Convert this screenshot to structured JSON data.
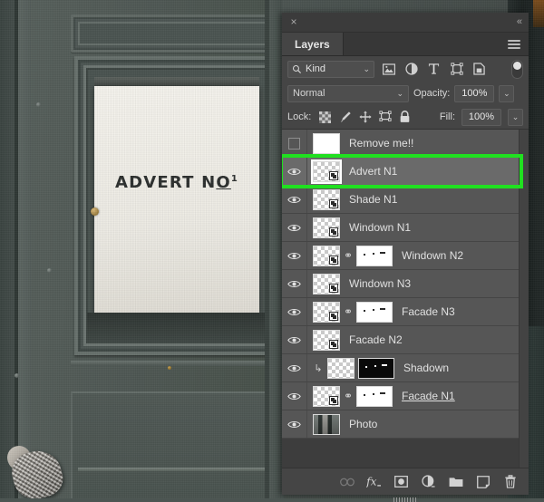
{
  "photo": {
    "poster_text_main": "ADVERT N",
    "poster_text_sup": "O",
    "poster_text_num": "1",
    "alt": "photo-of-dark-green-door-with-framed-advert-poster"
  },
  "panel": {
    "close_label": "×",
    "collapse_label": "«",
    "tab_label": "Layers",
    "menu_icon": "hamburger-menu-icon"
  },
  "filter_row": {
    "kind_label": "Kind",
    "search_icon": "search-icon",
    "caret": "⌄",
    "icons": [
      {
        "name": "filter-pixel-icon",
        "glyph": "image"
      },
      {
        "name": "filter-adjustment-icon",
        "glyph": "adjustment"
      },
      {
        "name": "filter-type-icon",
        "glyph": "T"
      },
      {
        "name": "filter-shape-icon",
        "glyph": "shape"
      },
      {
        "name": "filter-smart-object-icon",
        "glyph": "smart"
      }
    ],
    "toggle_name": "filter-enable-toggle"
  },
  "blend_row": {
    "blend_mode": "Normal",
    "opacity_label": "Opacity:",
    "opacity_value": "100%",
    "caret": "⌄"
  },
  "lock_row": {
    "lock_label": "Lock:",
    "fill_label": "Fill:",
    "fill_value": "100%",
    "caret": "⌄",
    "icons": [
      {
        "name": "lock-transparent-pixels-icon"
      },
      {
        "name": "lock-image-pixels-icon"
      },
      {
        "name": "lock-position-icon"
      },
      {
        "name": "lock-artboard-nesting-icon"
      },
      {
        "name": "lock-all-icon"
      }
    ]
  },
  "layers": [
    {
      "name": "Remove me!!",
      "visible": false,
      "selected": false,
      "kind": "white",
      "thumb": "white",
      "mask": null,
      "linked": false,
      "clipped": false,
      "editing": false
    },
    {
      "name": "Advert N1",
      "visible": true,
      "selected": true,
      "kind": "smart",
      "thumb": "checker",
      "mask": null,
      "linked": false,
      "clipped": false,
      "editing": false
    },
    {
      "name": "Shade N1",
      "visible": true,
      "selected": false,
      "kind": "smart",
      "thumb": "checker",
      "mask": null,
      "linked": false,
      "clipped": false,
      "editing": false
    },
    {
      "name": "Windown N1",
      "visible": true,
      "selected": false,
      "kind": "smart",
      "thumb": "checker",
      "mask": null,
      "linked": false,
      "clipped": false,
      "editing": false
    },
    {
      "name": "Windown N2",
      "visible": true,
      "selected": false,
      "kind": "smart",
      "thumb": "checker",
      "mask": "white",
      "linked": true,
      "clipped": false,
      "editing": false
    },
    {
      "name": "Windown N3",
      "visible": true,
      "selected": false,
      "kind": "smart",
      "thumb": "checker",
      "mask": null,
      "linked": false,
      "clipped": false,
      "editing": false
    },
    {
      "name": "Facade N3",
      "visible": true,
      "selected": false,
      "kind": "smart",
      "thumb": "checker",
      "mask": "white",
      "linked": true,
      "clipped": false,
      "editing": false
    },
    {
      "name": "Facade N2",
      "visible": true,
      "selected": false,
      "kind": "smart",
      "thumb": "checker",
      "mask": null,
      "linked": false,
      "clipped": false,
      "editing": false
    },
    {
      "name": "Shadown",
      "visible": true,
      "selected": false,
      "kind": "plain",
      "thumb": "checker",
      "mask": "black",
      "linked": false,
      "clipped": true,
      "editing": false
    },
    {
      "name": "Facade N1",
      "visible": true,
      "selected": false,
      "kind": "smart",
      "thumb": "checker",
      "mask": "white",
      "linked": true,
      "clipped": false,
      "editing": true
    },
    {
      "name": "Photo",
      "visible": true,
      "selected": false,
      "kind": "photo",
      "thumb": "photo",
      "mask": null,
      "linked": false,
      "clipped": false,
      "editing": false
    }
  ],
  "bottom_toolbar": [
    {
      "name": "link-layers-button",
      "glyph": "⚭",
      "dim": true
    },
    {
      "name": "layer-style-fx-button",
      "glyph": "fx",
      "dim": false
    },
    {
      "name": "add-layer-mask-button",
      "glyph": "mask",
      "dim": false
    },
    {
      "name": "new-adjustment-layer-button",
      "glyph": "adj",
      "dim": false
    },
    {
      "name": "new-group-button",
      "glyph": "folder",
      "dim": false
    },
    {
      "name": "new-layer-button",
      "glyph": "newlayer",
      "dim": false
    },
    {
      "name": "delete-layer-button",
      "glyph": "trash",
      "dim": false
    }
  ],
  "colors": {
    "highlight_green": "#20e020",
    "panel_bg": "#3b3b3b",
    "row_bg": "#565656",
    "row_selected_bg": "#6a6a6a",
    "toolbar_bg": "#454545"
  }
}
